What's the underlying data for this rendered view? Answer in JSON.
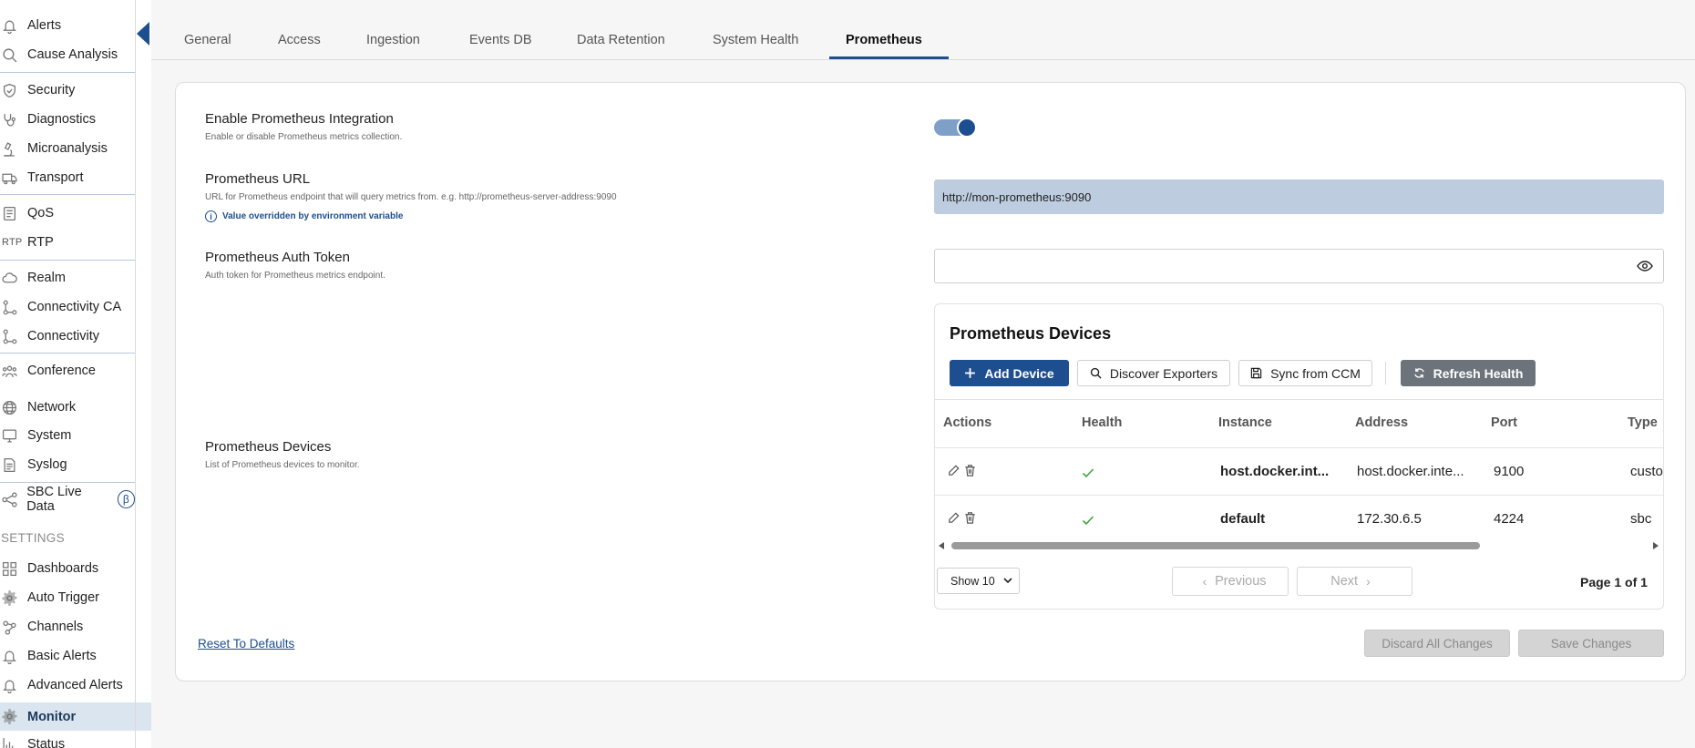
{
  "sidebar": {
    "items": [
      {
        "label": "Alerts",
        "icon": "bell-icon"
      },
      {
        "label": "Cause Analysis",
        "icon": "search-icon"
      },
      {
        "label": "Security",
        "icon": "shield-icon"
      },
      {
        "label": "Diagnostics",
        "icon": "stethoscope-icon"
      },
      {
        "label": "Microanalysis",
        "icon": "microscope-icon"
      },
      {
        "label": "Transport",
        "icon": "truck-icon"
      },
      {
        "label": "QoS",
        "icon": "document-list-icon"
      },
      {
        "label": "RTP",
        "icon": "rtp-text-icon",
        "icon_text": "RTP"
      },
      {
        "label": "Realm",
        "icon": "cloud-icon"
      },
      {
        "label": "Connectivity CA",
        "icon": "connection-nodes-icon"
      },
      {
        "label": "Connectivity",
        "icon": "connection-nodes-icon"
      },
      {
        "label": "Conference",
        "icon": "people-group-icon"
      },
      {
        "label": "Network",
        "icon": "globe-icon"
      },
      {
        "label": "System",
        "icon": "monitor-icon"
      },
      {
        "label": "Syslog",
        "icon": "file-text-icon"
      },
      {
        "label": "SBC Live Data",
        "icon": "share-nodes-icon",
        "badge": "β"
      }
    ],
    "settings_header": "SETTINGS",
    "settings_items": [
      {
        "label": "Dashboards",
        "icon": "grid-icon"
      },
      {
        "label": "Auto Trigger",
        "icon": "gear-icon"
      },
      {
        "label": "Channels",
        "icon": "channels-icon"
      },
      {
        "label": "Basic Alerts",
        "icon": "bell-icon"
      },
      {
        "label": "Advanced Alerts",
        "icon": "bell-icon"
      },
      {
        "label": "Monitor",
        "icon": "gear-icon",
        "active": true
      },
      {
        "label": "Status",
        "icon": "bar-chart-icon"
      }
    ]
  },
  "tabs": [
    {
      "label": "General"
    },
    {
      "label": "Access"
    },
    {
      "label": "Ingestion"
    },
    {
      "label": "Events DB"
    },
    {
      "label": "Data Retention"
    },
    {
      "label": "System Health"
    },
    {
      "label": "Prometheus",
      "active": true
    }
  ],
  "settings": {
    "enable": {
      "title": "Enable Prometheus Integration",
      "desc": "Enable or disable Prometheus metrics collection.",
      "value": true
    },
    "url": {
      "title": "Prometheus URL",
      "desc": "URL for Prometheus endpoint that will query metrics from. e.g. http://prometheus-server-address:9090",
      "override_note": "Value overridden by environment variable",
      "value": "http://mon-prometheus:9090"
    },
    "token": {
      "title": "Prometheus Auth Token",
      "desc": "Auth token for Prometheus metrics endpoint.",
      "value": ""
    },
    "devices": {
      "title": "Prometheus Devices",
      "desc": "List of Prometheus devices to monitor."
    }
  },
  "devices_card": {
    "title": "Prometheus Devices",
    "buttons": {
      "add": "Add Device",
      "discover": "Discover Exporters",
      "sync": "Sync from CCM",
      "refresh": "Refresh Health"
    },
    "columns": [
      "Actions",
      "Health",
      "Instance",
      "Address",
      "Port",
      "Type"
    ],
    "rows": [
      {
        "health": "ok",
        "instance": "host.docker.int...",
        "address": "host.docker.inte...",
        "port": "9100",
        "type": "custo"
      },
      {
        "health": "ok",
        "instance": "default",
        "address": "172.30.6.5",
        "port": "4224",
        "type": "sbc"
      }
    ],
    "show_select": "Show 10",
    "prev_label": "Previous",
    "next_label": "Next",
    "page_info": "Page 1 of 1"
  },
  "footer": {
    "reset": "Reset To Defaults",
    "discard": "Discard All Changes",
    "save": "Save Changes"
  },
  "colors": {
    "accent": "#1d4e8f",
    "active_bg": "#dae5f0",
    "url_bg": "#bdcddf",
    "refresh_bg": "#6c737a",
    "check": "#3ca63c"
  }
}
